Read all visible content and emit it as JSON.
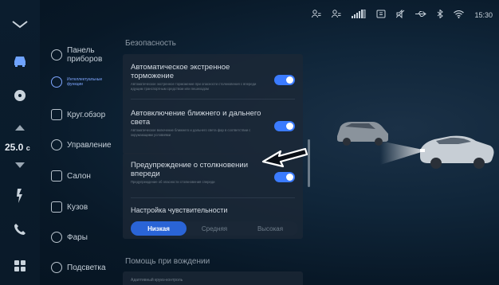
{
  "status": {
    "time": "15:30",
    "icons": [
      "profile-1-icon",
      "profile-2-icon",
      "signal-icon",
      "wifi-call-icon",
      "mute-icon",
      "usb-icon",
      "bluetooth-icon",
      "wifi-icon"
    ]
  },
  "rail": {
    "temperature": "25.0",
    "temperature_unit": "c",
    "icons": [
      "chevron-icon",
      "car-icon",
      "fan-icon",
      "up-icon",
      "down-icon",
      "seat-heat-icon",
      "phone-icon",
      "apps-icon"
    ]
  },
  "menu": {
    "items": [
      {
        "label": "Панель приборов",
        "icon": "gauge-icon"
      },
      {
        "label": "Интеллектуальные функции",
        "icon": "steering-icon",
        "active": true
      },
      {
        "label": "Круг.обзор",
        "icon": "camera-icon"
      },
      {
        "label": "Управление",
        "icon": "steer-control-icon"
      },
      {
        "label": "Салон",
        "icon": "seat-icon"
      },
      {
        "label": "Кузов",
        "icon": "car-body-icon"
      },
      {
        "label": "Фары",
        "icon": "bulb-icon"
      },
      {
        "label": "Подсветка",
        "icon": "light-icon"
      }
    ]
  },
  "settings": {
    "section_safety": "Безопасность",
    "aeb": {
      "title": "Автоматическое экстренное торможение",
      "desc": "Автоматическое экстренное торможение при опасности столкновения с впереди идущим транспортным средством или пешеходом",
      "on": true
    },
    "auto_lights": {
      "title": "Автовключение ближнего и дальнего света",
      "desc": "Автоматическое включение ближнего и дальнего света фар в соответствии с окружающими условиями",
      "on": true
    },
    "fcw": {
      "title": "Предупреждение о столкновении впереди",
      "desc": "Предупреждение об опасности столкновения спереди",
      "on": true
    },
    "sensitivity": {
      "title": "Настройка чувствительности",
      "options": [
        "Низкая",
        "Средняя",
        "Высокая"
      ],
      "selected": "Низкая"
    },
    "section_assist": "Помощь при вождении",
    "assist_peek": "Адаптивный круиз-контроль"
  },
  "colors": {
    "accent": "#3b7bff",
    "background": "#0a1a29",
    "card": "#1c2836"
  }
}
